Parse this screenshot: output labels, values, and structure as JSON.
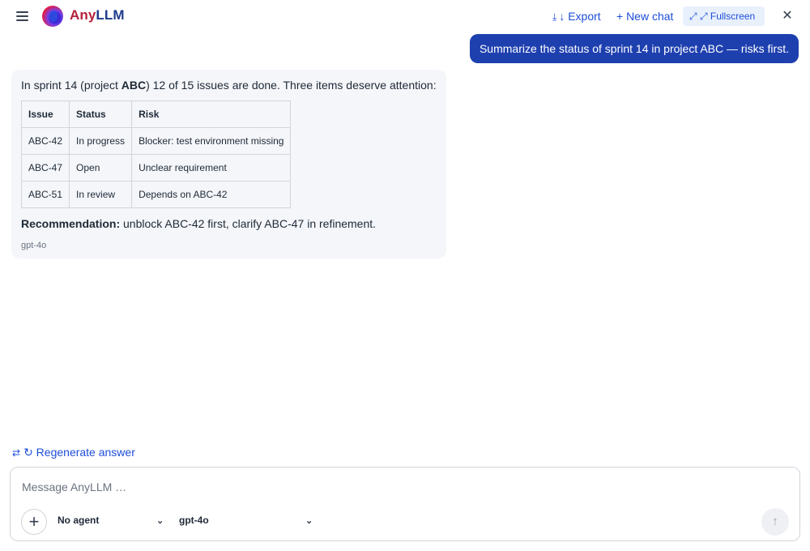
{
  "header": {
    "brand_prefix": "Any",
    "brand_suffix": "LLM",
    "export_icon": "download-icon",
    "export_label": "↓ Export",
    "new_chat_label": "+ New chat",
    "fullscreen_icon": "expand-icon",
    "fullscreen_label": "⤢ Fullscreen",
    "close_icon": "close-icon"
  },
  "conversation": {
    "user_message": "Summarize the status of sprint 14 in project ABC — risks first.",
    "assistant": {
      "intro_before": "In sprint 14 (project ",
      "intro_bold": "ABC",
      "intro_after": ") 12 of 15 issues are done. Three items deserve attention:",
      "table": {
        "headers": [
          "Issue",
          "Status",
          "Risk"
        ],
        "rows": [
          [
            "ABC-42",
            "In progress",
            "Blocker: test environment missing"
          ],
          [
            "ABC-47",
            "Open",
            "Unclear requirement"
          ],
          [
            "ABC-51",
            "In review",
            "Depends on ABC-42"
          ]
        ]
      },
      "recommendation_label": "Recommendation:",
      "recommendation_text": " unblock ABC-42 first, clarify ABC-47 in refinement.",
      "model": "gpt-4o"
    }
  },
  "regenerate": {
    "icon": "swap-icon",
    "label": "↻ Regenerate answer"
  },
  "composer": {
    "placeholder": "Message AnyLLM …",
    "value": "",
    "agent_selected": "No agent",
    "model_selected": "gpt-4o",
    "send_icon": "arrow-up-icon"
  }
}
